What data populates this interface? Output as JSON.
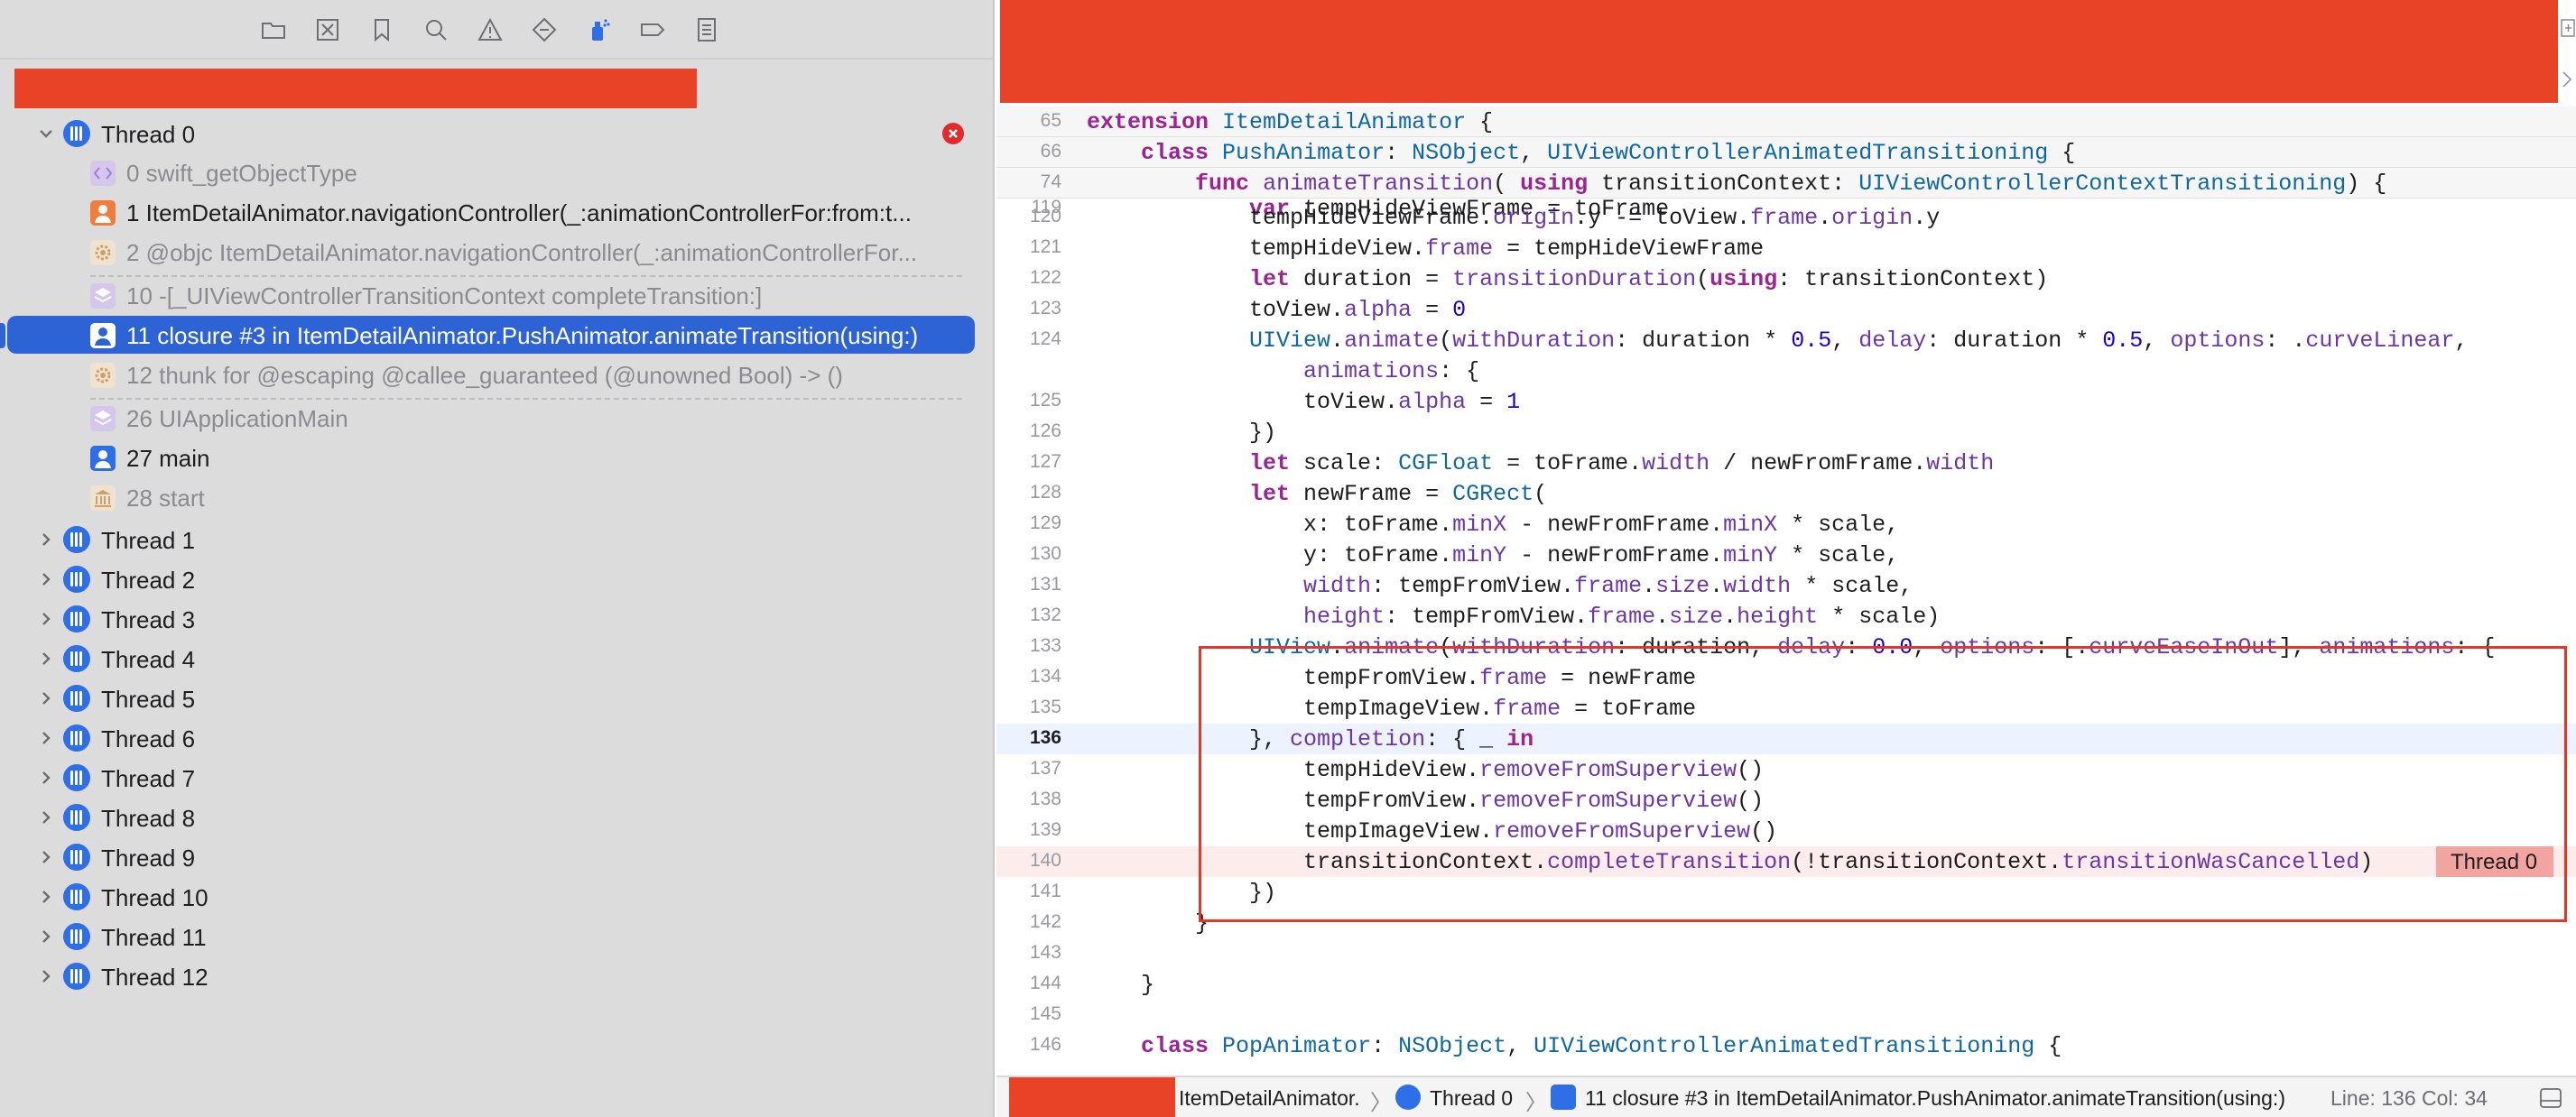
{
  "navigator": {
    "toolbar_icons": [
      "folder-icon",
      "x-square-icon",
      "bookmark-icon",
      "magnifier-icon",
      "warning-icon",
      "diamond-icon",
      "debug-spray-icon",
      "label-tag-icon",
      "report-list-icon"
    ],
    "thread0": {
      "label": "Thread 0",
      "frames": [
        {
          "label": "0 swift_getObjectType",
          "icon": "code-brackets-icon",
          "style": "dim"
        },
        {
          "label": "1 ItemDetailAnimator.navigationController(_:animationControllerFor:from:t...",
          "icon": "person-icon",
          "style": "strong"
        },
        {
          "label": "2 @objc ItemDetailAnimator.navigationController(_:animationControllerFor...",
          "icon": "gear-icon",
          "style": "dim"
        },
        {
          "label": "10 -[_UIViewControllerTransitionContext completeTransition:]",
          "icon": "layers-icon",
          "style": "dim"
        },
        {
          "label": "11 closure #3 in ItemDetailAnimator.PushAnimator.animateTransition(using:)",
          "icon": "person-icon",
          "style": "selected"
        },
        {
          "label": "12 thunk for @escaping @callee_guaranteed (@unowned Bool) -> ()",
          "icon": "gear-icon",
          "style": "dim"
        },
        {
          "label": "26 UIApplicationMain",
          "icon": "layers-icon",
          "style": "dim"
        },
        {
          "label": "27 main",
          "icon": "person-icon",
          "style": "strong"
        },
        {
          "label": "28 start",
          "icon": "columns-icon",
          "style": "dim"
        }
      ]
    },
    "other_threads": [
      "Thread 1",
      "Thread 2",
      "Thread 3",
      "Thread 4",
      "Thread 5",
      "Thread 6",
      "Thread 7",
      "Thread 8",
      "Thread 9",
      "Thread 10",
      "Thread 11",
      "Thread 12"
    ]
  },
  "editor": {
    "sticky": [
      {
        "ln": "65",
        "code": "extension ItemDetailAnimator {"
      },
      {
        "ln": "66",
        "code": "    class PushAnimator: NSObject, UIViewControllerAnimatedTransitioning {"
      },
      {
        "ln": "74",
        "code": "        func animateTransition( using transitionContext: UIViewControllerContextTransitioning) {"
      }
    ],
    "lines": [
      {
        "ln": "119",
        "code": "            var tempHideViewFrame = toFrame"
      },
      {
        "ln": "120",
        "code": "            tempHideViewFrame.origin.y -= toView.frame.origin.y"
      },
      {
        "ln": "121",
        "code": "            tempHideView.frame = tempHideViewFrame"
      },
      {
        "ln": "122",
        "code": "            let duration = transitionDuration(using: transitionContext)"
      },
      {
        "ln": "123",
        "code": "            toView.alpha = 0"
      },
      {
        "ln": "124",
        "code": "            UIView.animate(withDuration: duration * 0.5, delay: duration * 0.5, options: .curveLinear,"
      },
      {
        "ln": "",
        "code": "                animations: {"
      },
      {
        "ln": "125",
        "code": "                toView.alpha = 1"
      },
      {
        "ln": "126",
        "code": "            })"
      },
      {
        "ln": "127",
        "code": "            let scale: CGFloat = toFrame.width / newFromFrame.width"
      },
      {
        "ln": "128",
        "code": "            let newFrame = CGRect("
      },
      {
        "ln": "129",
        "code": "                x: toFrame.minX - newFromFrame.minX * scale,"
      },
      {
        "ln": "130",
        "code": "                y: toFrame.minY - newFromFrame.minY * scale,"
      },
      {
        "ln": "131",
        "code": "                width: tempFromView.frame.size.width * scale,"
      },
      {
        "ln": "132",
        "code": "                height: tempFromView.frame.size.height * scale)"
      },
      {
        "ln": "133",
        "code": "            UIView.animate(withDuration: duration, delay: 0.0, options: [.curveEaseInOut], animations: {"
      },
      {
        "ln": "134",
        "code": "                tempFromView.frame = newFrame"
      },
      {
        "ln": "135",
        "code": "                tempImageView.frame = toFrame"
      },
      {
        "ln": "136",
        "code": "            }, completion: { _ in"
      },
      {
        "ln": "137",
        "code": "                tempHideView.removeFromSuperview()"
      },
      {
        "ln": "138",
        "code": "                tempFromView.removeFromSuperview()"
      },
      {
        "ln": "139",
        "code": "                tempImageView.removeFromSuperview()"
      },
      {
        "ln": "140",
        "code": "                transitionContext.completeTransition(!transitionContext.transitionWasCancelled)"
      },
      {
        "ln": "141",
        "code": "            })"
      },
      {
        "ln": "142",
        "code": "        }"
      },
      {
        "ln": "143",
        "code": ""
      },
      {
        "ln": "144",
        "code": "    }"
      },
      {
        "ln": "145",
        "code": ""
      },
      {
        "ln": "146",
        "code": "    class PopAnimator: NSObject, UIViewControllerAnimatedTransitioning {"
      }
    ],
    "current_line": "136",
    "error_line": "140",
    "thread_badge": "Thread 0"
  },
  "jumpbar": {
    "file": "ItemDetailAnimator.",
    "thread": "Thread 0",
    "frame": "11 closure #3 in ItemDetailAnimator.PushAnimator.animateTransition(using:)",
    "position": "Line: 136  Col: 34"
  },
  "colors": {
    "accent": "#2e63d6",
    "redaction": "#e84327",
    "error": "#e0392a"
  }
}
